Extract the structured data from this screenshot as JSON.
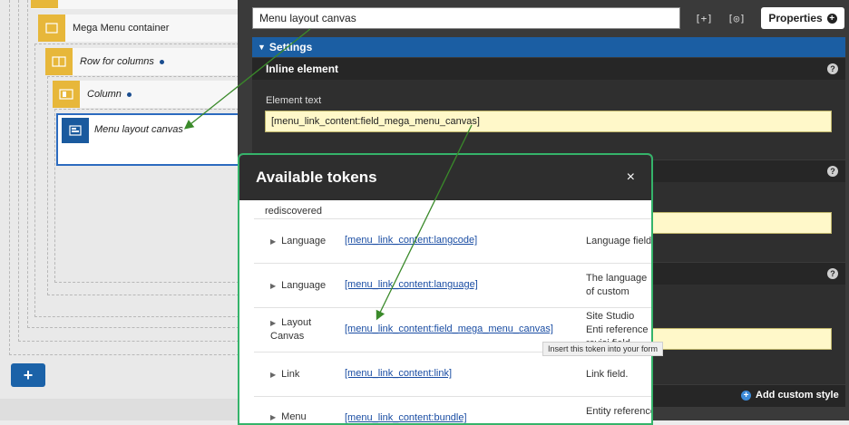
{
  "left_canvas": {
    "nodes": [
      {
        "label": "Mega Menu container",
        "italic": false,
        "dot": false
      },
      {
        "label": "Row for columns",
        "italic": true,
        "dot": true
      },
      {
        "label": "Column",
        "italic": true,
        "dot": true
      }
    ],
    "selected_node": {
      "label": "Menu layout canvas"
    },
    "add_button": "+"
  },
  "sidebar": {
    "title_input_value": "Menu layout canvas",
    "toolbar_icons": [
      "[+]",
      "[◎]"
    ],
    "properties_label": "Properties",
    "settings_label": "Settings",
    "section_inline_element": "Inline element",
    "element_text_label": "Element text",
    "element_text_value": "[menu_link_content:field_mega_menu_canvas]",
    "add_custom_style_label": "Add custom style"
  },
  "modal": {
    "title": "Available tokens",
    "close_glyph": "×",
    "partial_row_text": "should be\nrediscovered",
    "rows": [
      {
        "name": "Language",
        "token": "[menu_link_content:langcode]",
        "desc": "Language field."
      },
      {
        "name": "Language",
        "token": "[menu_link_content:language]",
        "desc": "The language of custom menu li"
      },
      {
        "name": "Layout\nCanvas",
        "token": "[menu_link_content:field_mega_menu_canvas]",
        "desc": "Site Studio Enti reference revisi field."
      },
      {
        "name": "Link",
        "token": "[menu_link_content:link]",
        "desc": "Link field."
      },
      {
        "name": "Menu",
        "token": "[menu_link_content:bundle]",
        "desc": "Entity reference"
      }
    ]
  },
  "tooltip": "Insert this token into your form",
  "colors": {
    "accent_blue": "#1b5ea3",
    "node_yellow": "#e7b73a",
    "modal_border_green": "#35b36a",
    "arrow_green": "#3a8a2a",
    "field_yellow": "#fff8c9"
  }
}
